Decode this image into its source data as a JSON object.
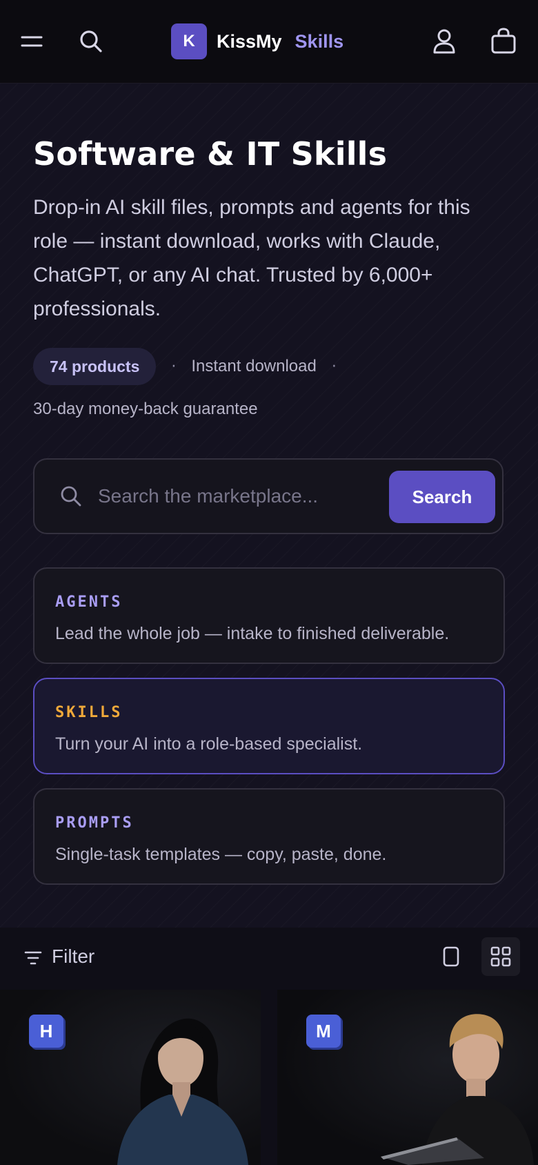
{
  "header": {
    "logo_letter": "K",
    "brand_name": "KissMy",
    "brand_accent": "Skills",
    "icons": [
      "menu-icon",
      "search-icon",
      "user-icon",
      "bag-icon"
    ]
  },
  "hero": {
    "title": "Software & IT Skills",
    "description": "Drop-in AI skill files, prompts and agents for this role — instant download, works with Claude, ChatGPT, or any AI chat. Trusted by 6,000+ professionals.",
    "product_count": "74 products",
    "separator": "·",
    "instant_download": "Instant download",
    "guarantee": "30-day money-back guarantee"
  },
  "search": {
    "placeholder": "Search the marketplace...",
    "button_label": "Search"
  },
  "categories": [
    {
      "kicker": "AGENTS",
      "description": "Lead the whole job — intake to finished deliverable.",
      "color": "#a99df5",
      "active": false
    },
    {
      "kicker": "SKILLS",
      "description": "Turn your AI into a role-based specialist.",
      "color": "#f0a93a",
      "active": true
    },
    {
      "kicker": "PROMPTS",
      "description": "Single-task templates — copy, paste, done.",
      "color": "#a99df5",
      "active": false
    }
  ],
  "toolbar": {
    "filter_label": "Filter",
    "view_modes": [
      "single-column",
      "grid"
    ],
    "active_view": "grid"
  },
  "products": [
    {
      "badge": "H",
      "badge_color": "#4a5fd6"
    },
    {
      "badge": "M",
      "badge_color": "#4a5fd6"
    }
  ],
  "colors": {
    "accent": "#5b4ec2",
    "accent_light": "#9f95f0",
    "background": "#0f0e17"
  }
}
